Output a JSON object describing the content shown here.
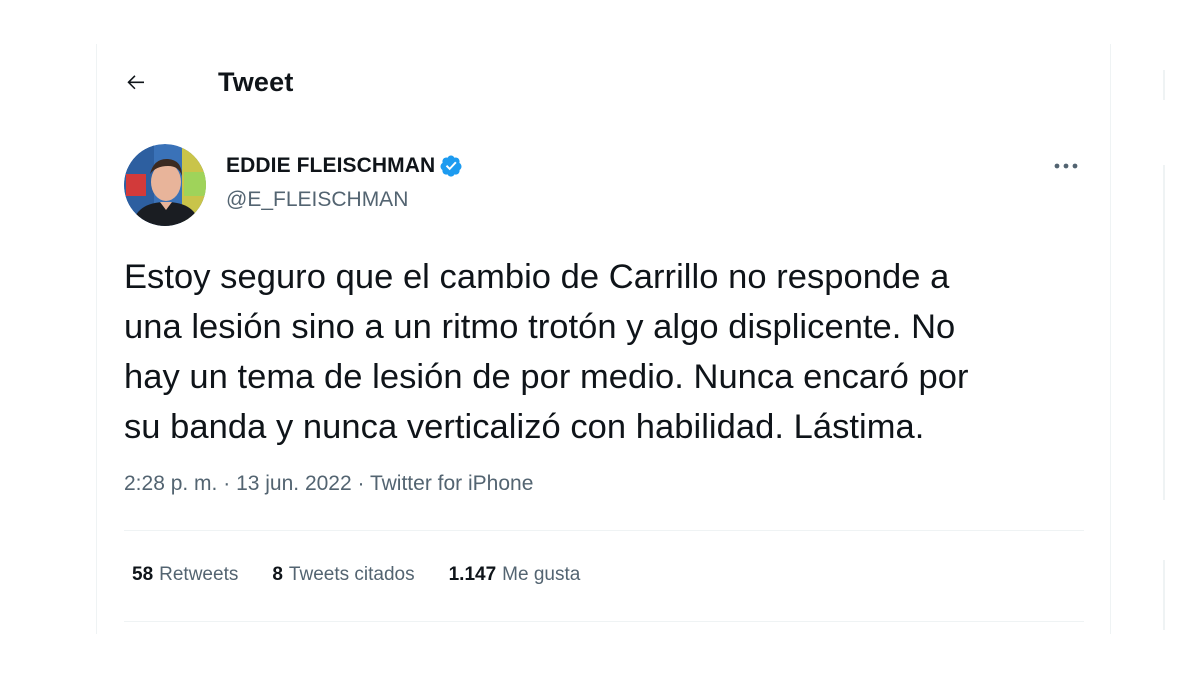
{
  "header": {
    "title": "Tweet",
    "back_icon": "arrow-left-icon"
  },
  "author": {
    "display_name": "EDDIE FLEISCHMAN",
    "handle": "@E_FLEISCHMAN",
    "verified_icon": "verified-badge-icon",
    "verified_color": "#1d9bf0"
  },
  "tweet": {
    "lines": [
      "Estoy seguro que el cambio de Carrillo no responde a",
      "una lesión sino a un ritmo trotón y algo displicente. No",
      "hay un tema de lesión de por medio. Nunca encaró por",
      "su banda y nunca verticalizó con habilidad. Lástima."
    ],
    "time": "2:28 p. m.",
    "date": "13 jun. 2022",
    "source": "Twitter for iPhone",
    "separator": "·"
  },
  "stats": {
    "retweets_count": "58",
    "retweets_label": "Retweets",
    "quotes_count": "8",
    "quotes_label": "Tweets citados",
    "likes_count": "1.147",
    "likes_label": "Me gusta"
  },
  "colors": {
    "text_primary": "#0f1419",
    "text_secondary": "#536471",
    "border": "#eff3f4",
    "accent": "#1d9bf0"
  }
}
